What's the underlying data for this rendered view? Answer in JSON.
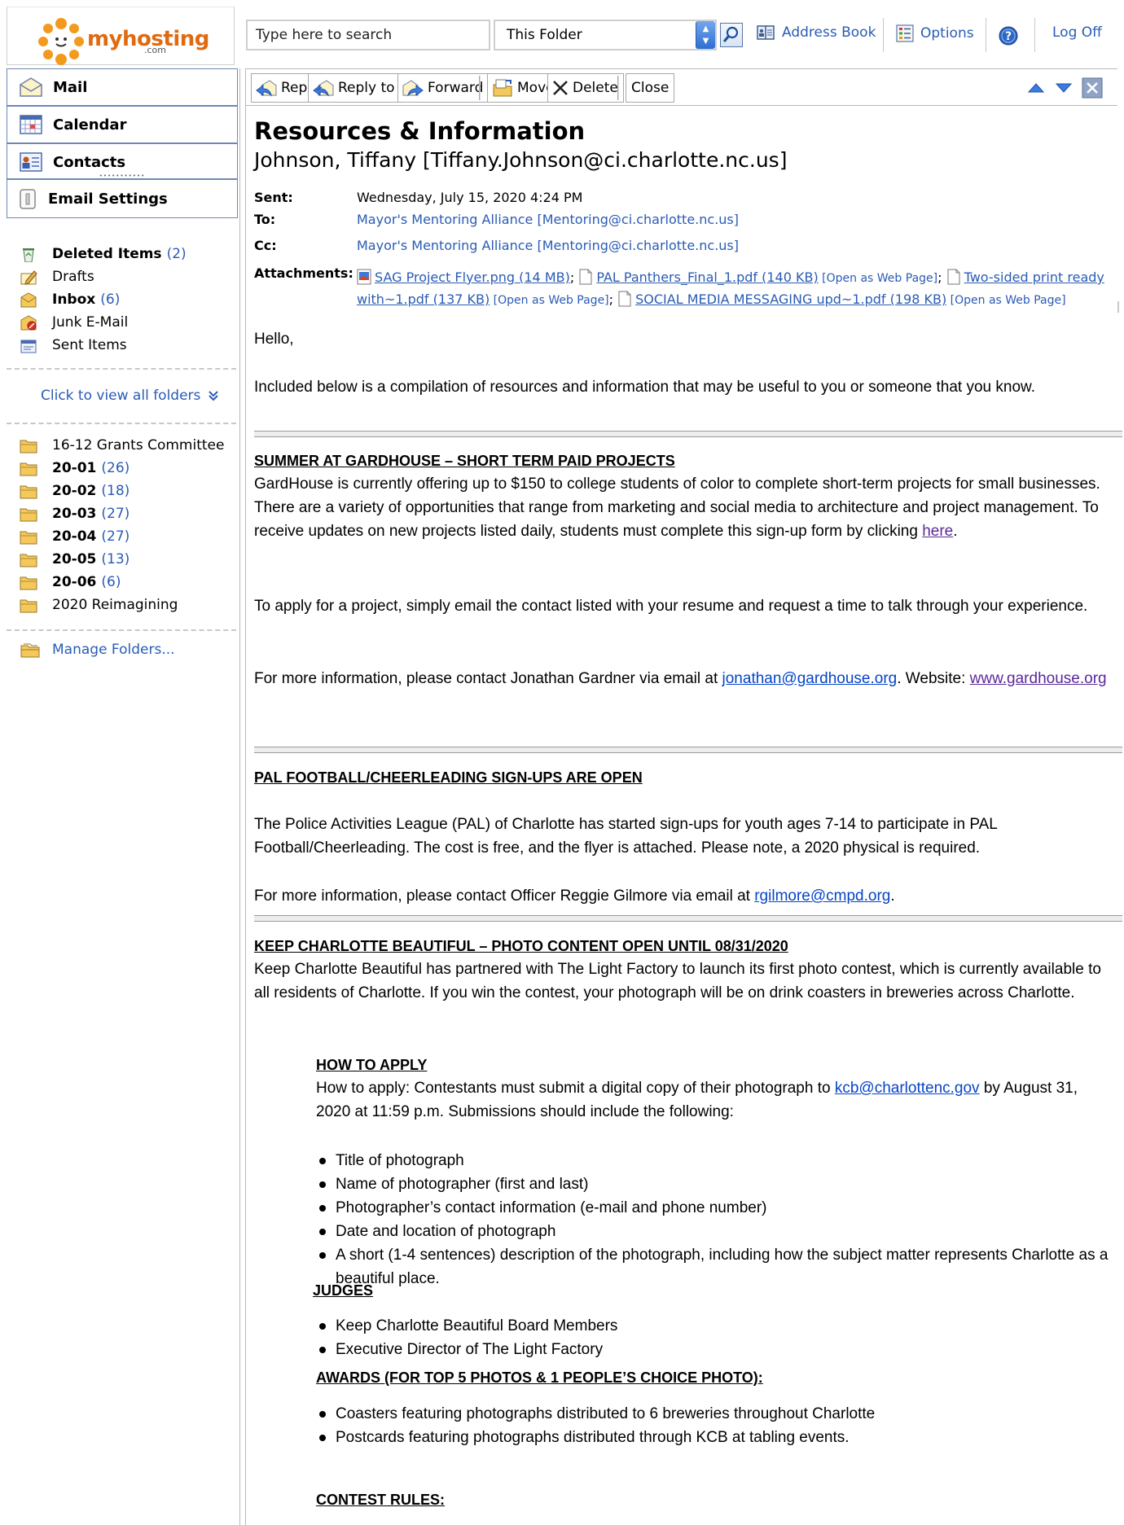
{
  "logo": {
    "name": "myhosting",
    "suffix": ".com"
  },
  "topbar": {
    "search_placeholder": "Type here to search",
    "scope": "This Folder",
    "address_book": "Address Book",
    "options": "Options",
    "log_off": "Log Off"
  },
  "nav": {
    "mail": "Mail",
    "calendar": "Calendar",
    "contacts": "Contacts",
    "email_settings": "Email Settings"
  },
  "folders": [
    {
      "name": "Deleted Items",
      "count": "(2)",
      "bold": true,
      "icon": "recycle-bin-icon"
    },
    {
      "name": "Drafts",
      "count": "",
      "bold": false,
      "icon": "drafts-icon"
    },
    {
      "name": "Inbox",
      "count": "(6)",
      "bold": true,
      "icon": "inbox-icon"
    },
    {
      "name": "Junk E-Mail",
      "count": "",
      "bold": false,
      "icon": "junk-mail-icon"
    },
    {
      "name": "Sent Items",
      "count": "",
      "bold": false,
      "icon": "sent-items-icon"
    }
  ],
  "view_all_folders": "Click to view all folders",
  "subfolders": [
    {
      "name": "16-12 Grants Committee",
      "count": "",
      "bold": false
    },
    {
      "name": "20-01",
      "count": "(26)",
      "bold": true
    },
    {
      "name": "20-02",
      "count": "(18)",
      "bold": true
    },
    {
      "name": "20-03",
      "count": "(27)",
      "bold": true
    },
    {
      "name": "20-04",
      "count": "(27)",
      "bold": true
    },
    {
      "name": "20-05",
      "count": "(13)",
      "bold": true
    },
    {
      "name": "20-06",
      "count": "(6)",
      "bold": true
    },
    {
      "name": "2020 Reimagining",
      "count": "",
      "bold": false
    }
  ],
  "manage_folders": "Manage Folders...",
  "toolbar": {
    "reply": "Reply",
    "reply_all": "Reply to All",
    "forward": "Forward",
    "move": "Move",
    "delete": "Delete",
    "close": "Close"
  },
  "message": {
    "subject": "Resources & Information",
    "from": "Johnson, Tiffany [Tiffany.Johnson@ci.charlotte.nc.us]",
    "sent_label": "Sent:",
    "sent": "Wednesday, July 15, 2020 4:24 PM",
    "to_label": "To:",
    "to": "Mayor's Mentoring Alliance [Mentoring@ci.charlotte.nc.us]",
    "cc_label": "Cc:",
    "cc": "Mayor's Mentoring Alliance [Mentoring@ci.charlotte.nc.us]",
    "attachments_label": "Attachments:",
    "attachments": [
      {
        "name": "SAG Project Flyer.png (14 MB)",
        "web": ""
      },
      {
        "name": "PAL Panthers_Final_1.pdf (140 KB)",
        "web": "Open as Web Page"
      },
      {
        "name": "Two-sided print ready with~1.pdf (137 KB)",
        "web": "Open as Web Page"
      },
      {
        "name": "SOCIAL MEDIA MESSAGING upd~1.pdf (198 KB)",
        "web": "Open as Web Page"
      }
    ]
  },
  "body": {
    "greeting": "Hello,",
    "intro": "Included below is a compilation of resources and information that may be useful to you or someone that you know.",
    "s1_title": "SUMMER AT GARDHOUSE – SHORT TERM PAID PROJECTS",
    "s1_p1": "GardHouse is currently offering up to $150 to college students of color to complete short-term projects for small businesses. There are a variety of opportunities that range from marketing and social media to architecture and project management. To receive updates on new projects listed daily, students must complete this sign-up form by clicking ",
    "s1_here": "here",
    "s1_p2": "To apply for a project, simply email the contact listed with your resume and request a time to talk through your experience.",
    "s1_p3_pre": "For more information, please contact Jonathan Gardner via email at ",
    "s1_email": "jonathan@gardhouse.org",
    "s1_p3_mid": ". Website: ",
    "s1_site": "www.gardhouse.org",
    "s2_title": "PAL FOOTBALL/CHEERLEADING SIGN-UPS ARE OPEN",
    "s2_p1": "The Police Activities League (PAL) of Charlotte has started sign-ups for youth ages 7-14 to participate in PAL Football/Cheerleading. The cost is free, and the flyer is attached. Please note, a 2020 physical is required.",
    "s2_p2_pre": "For more information, please contact Officer Reggie Gilmore via email at ",
    "s2_email": "rgilmore@cmpd.org",
    "s3_title": "KEEP CHARLOTTE BEAUTIFUL – PHOTO CONTENT OPEN UNTIL 08/31/2020",
    "s3_p1": "Keep Charlotte Beautiful has partnered with The Light Factory to launch its first photo contest, which is currently available to all residents of Charlotte. If you win the contest, your photograph will be on drink coasters in breweries across Charlotte.",
    "how_title": "HOW TO APPLY",
    "how_pre": "How to apply: Contestants must submit a digital copy of their photograph to ",
    "how_email": "kcb@charlottenc.gov",
    "how_post": " by August 31, 2020 at 11:59 p.m. Submissions should include the following:",
    "how_items": [
      "Title of photograph",
      "Name of photographer (first and last)",
      "Photographer’s contact information (e-mail and phone number)",
      "Date and location of photograph",
      "A short (1-4 sentences) description of the photograph, including how the subject matter represents Charlotte as a beautiful place."
    ],
    "judges_title": "JUDGES",
    "judges_items": [
      "Keep Charlotte Beautiful Board Members",
      "Executive Director of The Light Factory"
    ],
    "awards_title": "AWARDS (FOR TOP 5 PHOTOS & 1 PEOPLE’S CHOICE PHOTO):",
    "awards_items": [
      "Coasters featuring photographs distributed to 6 breweries throughout Charlotte",
      "Postcards featuring photographs distributed through KCB at tabling events."
    ],
    "rules_title": "CONTEST RULES:"
  }
}
